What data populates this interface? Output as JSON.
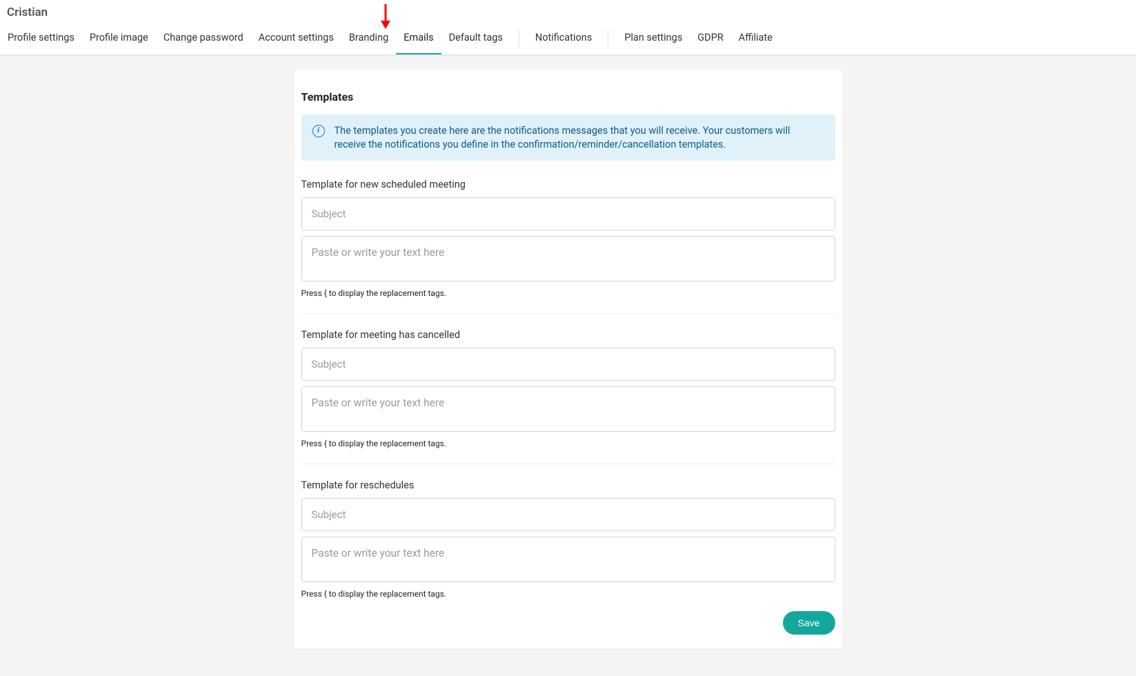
{
  "header": {
    "title": "Cristian",
    "tabs": [
      {
        "label": "Profile settings"
      },
      {
        "label": "Profile image"
      },
      {
        "label": "Change password"
      },
      {
        "label": "Account settings"
      },
      {
        "label": "Branding"
      },
      {
        "label": "Emails",
        "active": true
      },
      {
        "label": "Default tags"
      }
    ],
    "tabs_group2": [
      {
        "label": "Notifications"
      }
    ],
    "tabs_group3": [
      {
        "label": "Plan settings"
      },
      {
        "label": "GDPR"
      },
      {
        "label": "Affiliate"
      }
    ]
  },
  "card": {
    "title": "Templates",
    "info": "The templates you create here are the notifications messages that you will receive. Your customers will receive the notifications you define in the confirmation/reminder/cancellation templates.",
    "hint": "Press { to display the replacement tags.",
    "subject_placeholder": "Subject",
    "body_placeholder": "Paste or write your text here",
    "templates": [
      {
        "label": "Template for new scheduled meeting",
        "subject": "",
        "body": ""
      },
      {
        "label": "Template for meeting has cancelled",
        "subject": "",
        "body": ""
      },
      {
        "label": "Template for reschedules",
        "subject": "",
        "body": ""
      }
    ],
    "save_label": "Save"
  },
  "annotation": {
    "arrow_color": "#ff0000"
  }
}
